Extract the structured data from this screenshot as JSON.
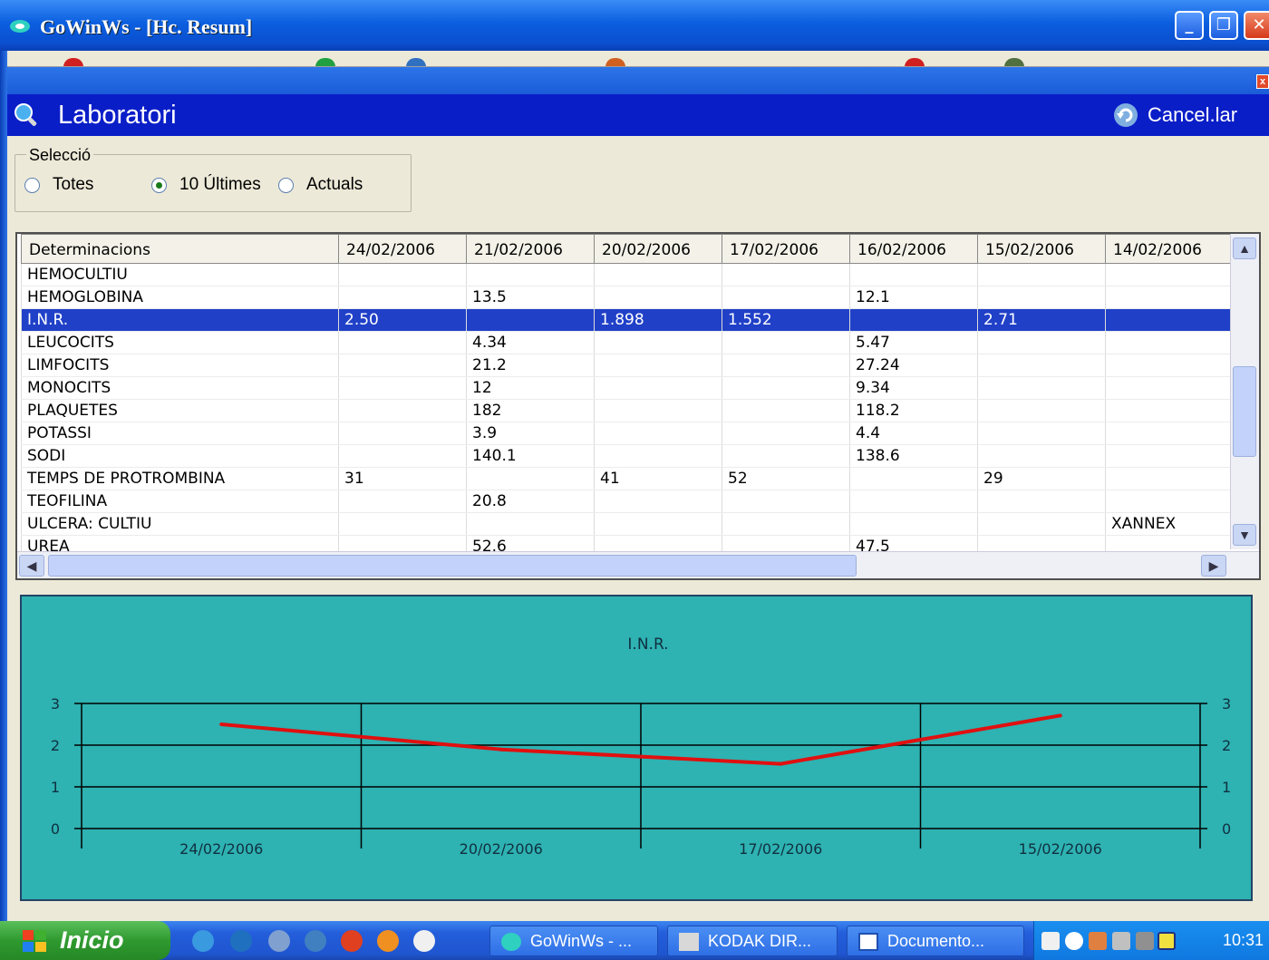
{
  "window": {
    "title": "GoWinWs - [Hc. Resum]"
  },
  "inner_close_label": "x",
  "header": {
    "title": "Laboratori",
    "cancel_label": "Cancel.lar"
  },
  "selection": {
    "legend": "Selecció",
    "options": [
      "Totes",
      "10 Últimes",
      "Actuals"
    ],
    "selected": "10 Últimes"
  },
  "grid": {
    "columns": [
      "Determinacions",
      "24/02/2006",
      "21/02/2006",
      "20/02/2006",
      "17/02/2006",
      "16/02/2006",
      "15/02/2006",
      "14/02/2006"
    ],
    "selected_row": "I.N.R.",
    "rows": [
      [
        "HEMOCULTIU",
        "",
        "",
        "",
        "",
        "",
        "",
        ""
      ],
      [
        "HEMOGLOBINA",
        "",
        "13.5",
        "",
        "",
        "12.1",
        "",
        ""
      ],
      [
        "I.N.R.",
        "2.50",
        "",
        "1.898",
        "1.552",
        "",
        "2.71",
        ""
      ],
      [
        "LEUCOCITS",
        "",
        "4.34",
        "",
        "",
        "5.47",
        "",
        ""
      ],
      [
        "LIMFOCITS",
        "",
        "21.2",
        "",
        "",
        "27.24",
        "",
        ""
      ],
      [
        "MONOCITS",
        "",
        "12",
        "",
        "",
        "9.34",
        "",
        ""
      ],
      [
        "PLAQUETES",
        "",
        "182",
        "",
        "",
        "118.2",
        "",
        ""
      ],
      [
        "POTASSI",
        "",
        "3.9",
        "",
        "",
        "4.4",
        "",
        ""
      ],
      [
        "SODI",
        "",
        "140.1",
        "",
        "",
        "138.6",
        "",
        ""
      ],
      [
        "TEMPS DE PROTROMBINA",
        "31",
        "",
        "41",
        "52",
        "",
        "29",
        ""
      ],
      [
        "TEOFILINA",
        "",
        "20.8",
        "",
        "",
        "",
        "",
        ""
      ],
      [
        "ULCERA: CULTIU",
        "",
        "",
        "",
        "",
        "",
        "",
        "XANNEX"
      ],
      [
        "UREA",
        "",
        "52.6",
        "",
        "",
        "47.5",
        "",
        ""
      ]
    ]
  },
  "chart_data": {
    "type": "line",
    "title": "I.N.R.",
    "categories": [
      "24/02/2006",
      "20/02/2006",
      "17/02/2006",
      "15/02/2006"
    ],
    "series": [
      {
        "values": [
          2.5,
          1.898,
          1.552,
          2.71
        ]
      }
    ],
    "ylim": [
      0,
      3
    ],
    "yticks": [
      0,
      1,
      2,
      3
    ],
    "y_axis_both_sides": true,
    "grid": true,
    "line_color": "#e01010",
    "background_color": "#2eb2b2"
  },
  "taskbar": {
    "start_label": "Inicio",
    "tasks": [
      "GoWinWs - ...",
      "KODAK DIR...",
      "Documento..."
    ],
    "clock": "10:31"
  }
}
